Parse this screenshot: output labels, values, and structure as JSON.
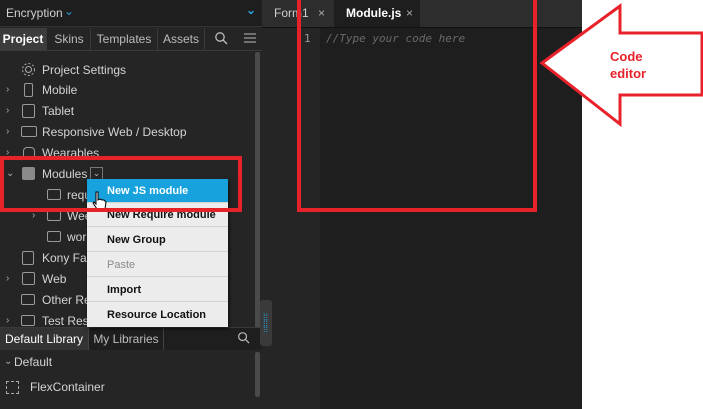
{
  "project_panel": {
    "title": "Encryption",
    "tabs": [
      {
        "label": "Project",
        "active": true
      },
      {
        "label": "Skins"
      },
      {
        "label": "Templates"
      },
      {
        "label": "Assets"
      }
    ],
    "tree": [
      {
        "label": "Project Settings",
        "icon": "gear-icon"
      },
      {
        "label": "Mobile",
        "icon": "mobile-icon"
      },
      {
        "label": "Tablet",
        "icon": "tablet-icon"
      },
      {
        "label": "Responsive Web / Desktop",
        "icon": "desktop-icon"
      },
      {
        "label": "Wearables",
        "icon": "watch-icon"
      },
      {
        "label": "Modules",
        "icon": "module-icon"
      },
      {
        "label": "requ",
        "icon": "folder-icon"
      },
      {
        "label": "Wee",
        "icon": "folder-icon"
      },
      {
        "label": "wor",
        "icon": "folder-icon"
      },
      {
        "label": "Kony Fab",
        "icon": "code-icon"
      },
      {
        "label": "Web",
        "icon": "web-icon"
      },
      {
        "label": "Other Res",
        "icon": "folder-icon"
      },
      {
        "label": "Test Res",
        "icon": "folder-icon"
      }
    ]
  },
  "context_menu": {
    "items": [
      {
        "label": "New JS module",
        "highlighted": true
      },
      {
        "label": "New Require module"
      },
      {
        "label": "New Group"
      },
      {
        "label": "Paste",
        "disabled": true
      },
      {
        "label": "Import"
      },
      {
        "label": "Resource Location"
      }
    ]
  },
  "library": {
    "tabs": [
      {
        "label": "Default Library",
        "active": true
      },
      {
        "label": "My Libraries"
      }
    ],
    "section": "Default",
    "items": [
      "FlexContainer"
    ]
  },
  "editor": {
    "tabs": [
      {
        "label": "Form1",
        "close": "×"
      },
      {
        "label": "Module.js",
        "close": "×",
        "active": true
      }
    ],
    "line_number": "1",
    "placeholder": "//Type your code here"
  },
  "annotation": {
    "text_line1": "Code",
    "text_line2": "editor",
    "color": "#e8222a"
  }
}
